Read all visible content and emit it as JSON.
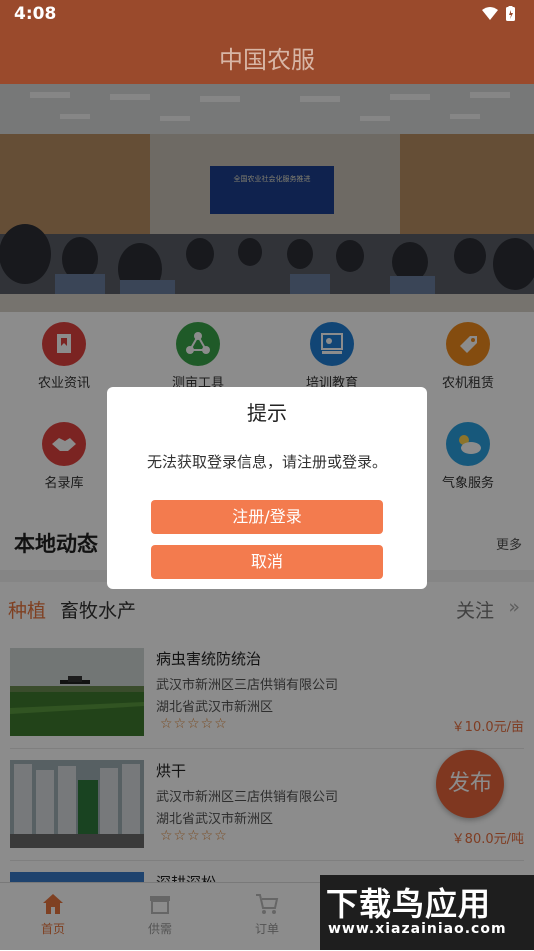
{
  "status": {
    "time": "4:08"
  },
  "app": {
    "title": "中国农服"
  },
  "banner": {
    "sign_text": "全国农业社会化服务推进"
  },
  "grid": [
    {
      "label": "农业资讯",
      "color": "#e0423e",
      "icon": "bookmark-icon"
    },
    {
      "label": "测亩工具",
      "color": "#3aa449",
      "icon": "share-nodes-icon"
    },
    {
      "label": "培训教育",
      "color": "#1f7fd6",
      "icon": "presentation-icon"
    },
    {
      "label": "农机租赁",
      "color": "#f08a1c",
      "icon": "tag-icon"
    },
    {
      "label": "名录库",
      "color": "#e0423e",
      "icon": "handshake-icon"
    },
    {
      "label": "气象服务",
      "color": "#2aa0e0",
      "icon": "weather-icon"
    }
  ],
  "local": {
    "title": "本地动态",
    "more": "更多"
  },
  "tabs": {
    "planting": "种植",
    "livestock": "畜牧水产",
    "follow": "关注"
  },
  "listings": [
    {
      "name": "病虫害统防统治",
      "company": "武汉市新洲区三店供销有限公司",
      "address": "湖北省武汉市新洲区",
      "stars": "☆☆☆☆☆",
      "price": "￥10.0元/亩"
    },
    {
      "name": "烘干",
      "company": "武汉市新洲区三店供销有限公司",
      "address": "湖北省武汉市新洲区",
      "stars": "☆☆☆☆☆",
      "price": "￥80.0元/吨"
    },
    {
      "name": "深耕深松"
    }
  ],
  "fab": {
    "label": "发布"
  },
  "bottom_nav": [
    {
      "label": "首页",
      "active": true
    },
    {
      "label": "供需",
      "active": false
    },
    {
      "label": "订单",
      "active": false
    }
  ],
  "dialog": {
    "title": "提示",
    "message": "无法获取登录信息，请注册或登录。",
    "primary": "注册/登录",
    "secondary": "取消"
  },
  "watermark": {
    "line1": "下载鸟应用",
    "line2": "www.xiazainiao.com"
  },
  "colors": {
    "brand": "#9a4a2c",
    "accent": "#f37b4e"
  }
}
